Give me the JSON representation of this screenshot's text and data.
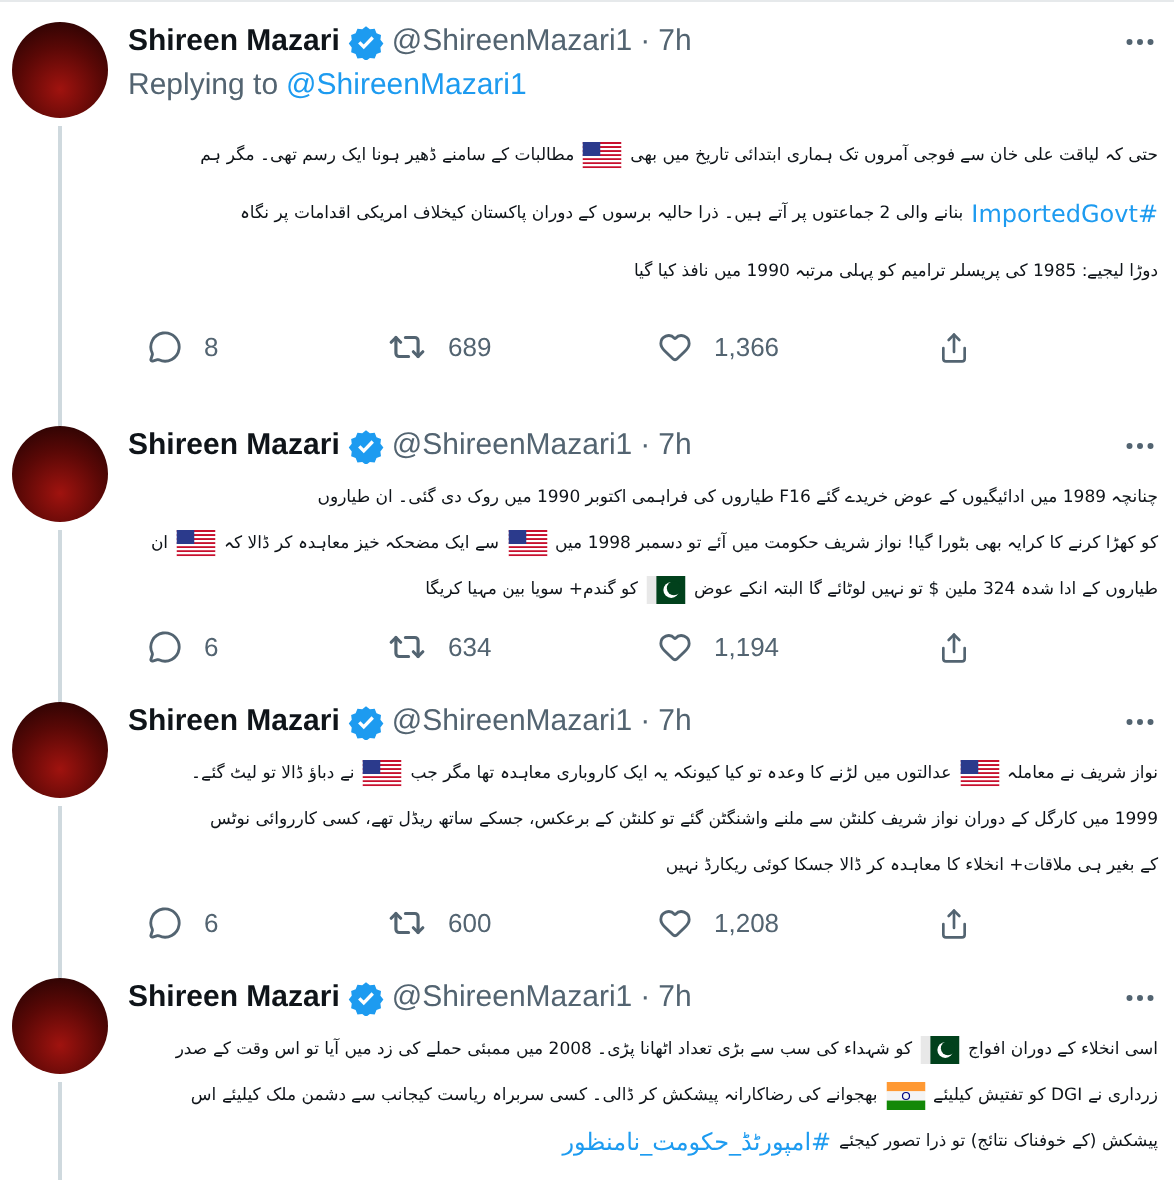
{
  "tweets": [
    {
      "author": "Shireen Mazari",
      "verified": true,
      "handle": "@ShireenMazari1",
      "dot": "·",
      "time": "7h",
      "reply_to": {
        "label": "Replying to",
        "handle": "@ShireenMazari1"
      },
      "lines": [
        [
          {
            "kind": "text",
            "text": "حتی کہ لیاقت علی خان سے فوجی آمروں تک ہماری ابتدائی تاریخ میں بھی"
          },
          {
            "kind": "flag_us"
          },
          {
            "kind": "text",
            "text": "مطالبات کے سامنے ڈھیر ہونا ایک رسم تھی۔ مگر ہم"
          }
        ],
        [
          {
            "kind": "hashtag",
            "text": "#ImportedGovt"
          },
          {
            "kind": "text",
            "text": "بنانے والی 2 جماعتوں پر آتے ہیں۔ ذرا حالیہ برسوں کے دوران پاکستان کیخلاف امریکی اقدامات پر نگاہ"
          }
        ],
        [
          {
            "kind": "text",
            "text": "دوڑا لیجیے: 1985 کی پریسلر ترامیم کو پہلی مرتبہ 1990 میں نافذ کیا گیا"
          }
        ]
      ],
      "replies": "8",
      "retweets": "689",
      "likes": "1,366"
    },
    {
      "author": "Shireen Mazari",
      "verified": true,
      "handle": "@ShireenMazari1",
      "dot": "·",
      "time": "7h",
      "lines": [
        [
          {
            "kind": "text",
            "text": "چنانچہ 1989 میں ادائیگیوں کے عوض خریدے گئے F16 طیاروں کی فراہمی اکتوبر 1990 میں روک دی گئی۔ ان طیاروں"
          }
        ],
        [
          {
            "kind": "text",
            "text": "کو کھڑا کرنے کا کرایہ بھی بٹورا گیا! نواز شریف حکومت میں آئے تو دسمبر 1998 میں"
          },
          {
            "kind": "flag_us"
          },
          {
            "kind": "text",
            "text": "سے ایک مضحکہ خیز معاہدہ کر ڈالا کہ"
          },
          {
            "kind": "flag_us"
          },
          {
            "kind": "text",
            "text": "ان"
          }
        ],
        [
          {
            "kind": "text",
            "text": "طیاروں کے ادا شدہ 324 ملین $ تو نہیں لوٹائے گا البتہ انکے عوض"
          },
          {
            "kind": "flag_pk"
          },
          {
            "kind": "text",
            "text": "کو گندم+ سویا بین مہیا کریگا"
          }
        ]
      ],
      "replies": "6",
      "retweets": "634",
      "likes": "1,194"
    },
    {
      "author": "Shireen Mazari",
      "verified": true,
      "handle": "@ShireenMazari1",
      "dot": "·",
      "time": "7h",
      "lines": [
        [
          {
            "kind": "text",
            "text": "نواز شریف نے معاملہ"
          },
          {
            "kind": "flag_us"
          },
          {
            "kind": "text",
            "text": "عدالتوں میں لڑنے کا وعدہ تو کیا کیونکہ یہ ایک کاروباری معاہدہ تھا مگر جب"
          },
          {
            "kind": "flag_us"
          },
          {
            "kind": "text",
            "text": "نے دباؤ ڈالا تو لیٹ گئے۔"
          }
        ],
        [
          {
            "kind": "text",
            "text": "1999 میں کارگل کے دوران نواز شریف کلنٹن سے ملنے واشنگٹن گئے تو کلنٹن کے برعکس، جسکے ساتھ ریڈل تھے، کسی کارروائی نوٹس"
          }
        ],
        [
          {
            "kind": "text",
            "text": "کے بغیر ہی ملاقات+ انخلاء کا معاہدہ کر ڈالا جسکا کوئی ریکارڈ نہیں"
          }
        ]
      ],
      "replies": "6",
      "retweets": "600",
      "likes": "1,208"
    },
    {
      "author": "Shireen Mazari",
      "verified": true,
      "handle": "@ShireenMazari1",
      "dot": "·",
      "time": "7h",
      "lines": [
        [
          {
            "kind": "text",
            "text": "اسی انخلاء کے دوران افواج"
          },
          {
            "kind": "flag_pk"
          },
          {
            "kind": "text",
            "text": "کو شہداء کی سب سے بڑی تعداد اٹھانا پڑی۔ 2008 میں ممبئی حملے کی زد میں آیا تو اس وقت کے صدر"
          }
        ],
        [
          {
            "kind": "text",
            "text": "زرداری نے DGI کو تفتیش کیلیئے"
          },
          {
            "kind": "flag_in"
          },
          {
            "kind": "text",
            "text": "بھجوانے کی رضاکارانہ پیشکش کر ڈالی۔ کسی سربراہ ریاست کیجانب سے دشمن ملک کیلیئے اس"
          }
        ],
        [
          {
            "kind": "text",
            "text": "پیشکش (کے خوفناک نتائج) تو ذرا تصور کیجئے"
          },
          {
            "kind": "hashtag",
            "text": "#امپورٹڈ_حکومت_نامنظور"
          }
        ]
      ]
    }
  ]
}
